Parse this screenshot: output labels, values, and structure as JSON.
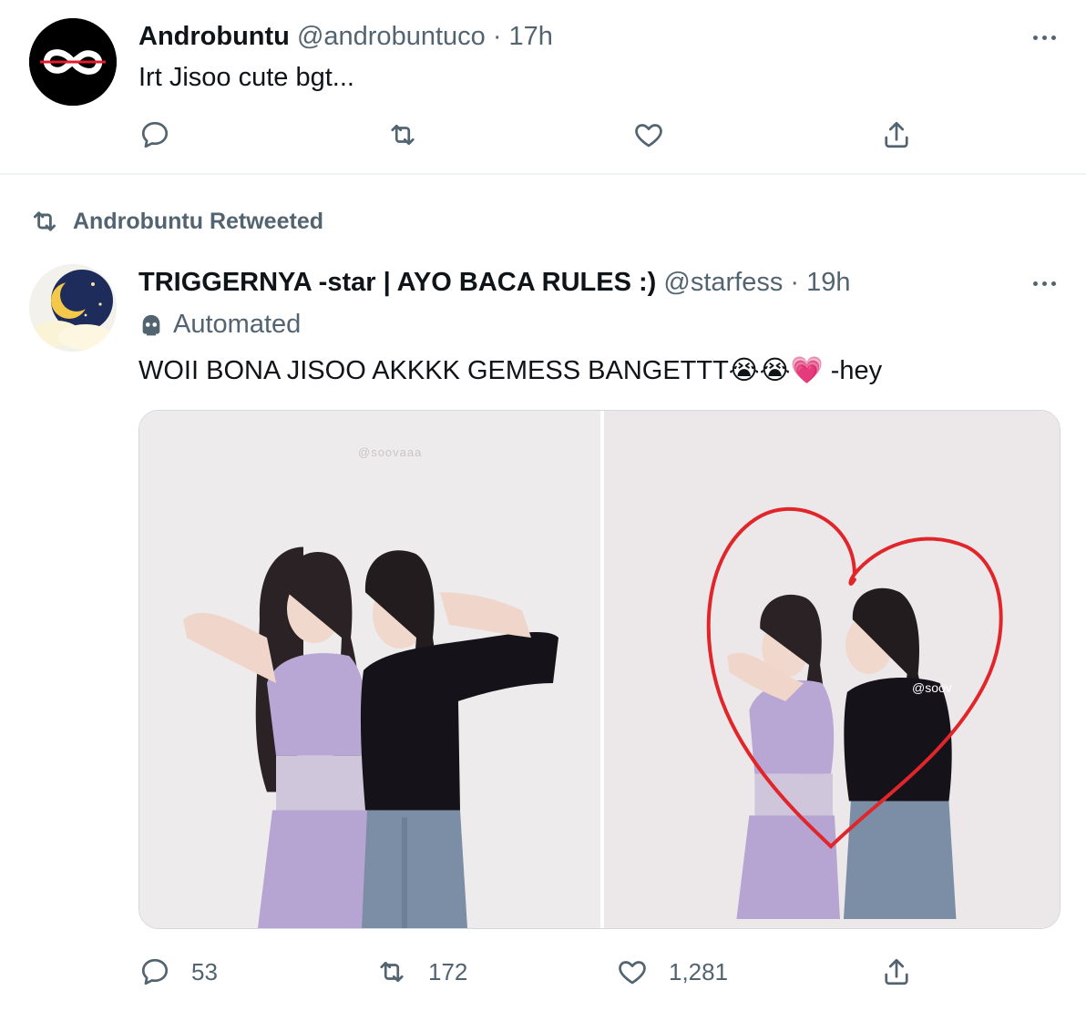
{
  "tweet1": {
    "display_name": "Androbuntu",
    "handle": "@androbuntuco",
    "time": "· 17h",
    "text": "Irt Jisoo cute bgt...",
    "avatar_icon": "infinity-logo-icon"
  },
  "retweet_label": "Androbuntu Retweeted",
  "tweet2": {
    "display_name": "TRIGGERNYA -star | AYO BACA RULES :)",
    "handle": "@starfess",
    "time": "· 19h",
    "automated_label": "Automated",
    "text": "WOII BONA JISOO AKKKK GEMESS BANGETTT😭😭💗 -hey",
    "watermark_left": "@soovaaa",
    "watermark_right": "@soov",
    "stats": {
      "replies": "53",
      "retweets": "172",
      "likes": "1,281"
    }
  },
  "colors": {
    "text_primary": "#0f1419",
    "text_secondary": "#536471",
    "divider": "#eff3f4",
    "heart_doodle": "#e0262b"
  }
}
